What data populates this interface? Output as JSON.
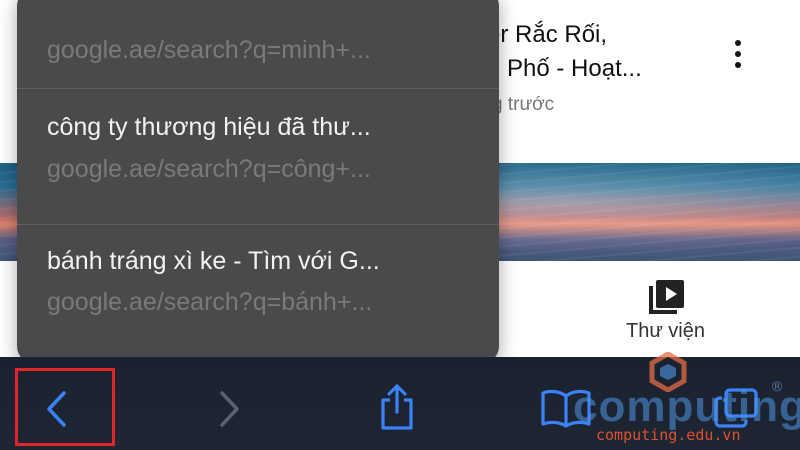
{
  "background_page": {
    "video_title_line1": "er Rắc Rối,",
    "video_title_line2": "u Phố - Hoạt...",
    "video_meta": "g trước",
    "library_label": "Thư viện"
  },
  "history_menu": {
    "items": [
      {
        "title": "",
        "url": "google.ae/search?q=minh+..."
      },
      {
        "title": "công ty thương hiệu đã thư...",
        "url": "google.ae/search?q=công+..."
      },
      {
        "title": "bánh tráng xì ke - Tìm với G...",
        "url": "google.ae/search?q=bánh+..."
      }
    ]
  },
  "toolbar": {
    "buttons": [
      "back-icon",
      "forward-icon",
      "share-icon",
      "bookmarks-icon",
      "tabs-icon"
    ],
    "accent_color": "#3b82f6",
    "highlight_color": "#e3242b"
  },
  "watermark": {
    "brand": "computing",
    "url": "computing.edu.vn",
    "registered": "®"
  }
}
